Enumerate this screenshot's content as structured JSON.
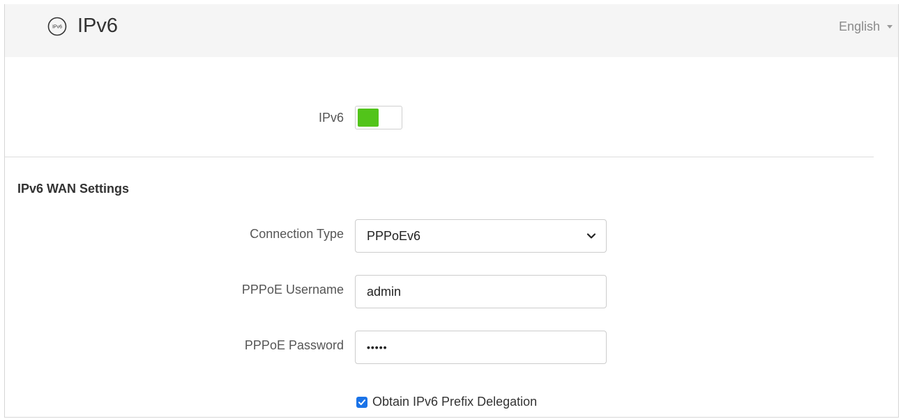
{
  "header": {
    "title": "IPv6",
    "icon": "ipv6-badge-icon",
    "icon_text": "IPv6",
    "language": {
      "selected": "English"
    }
  },
  "ipv6_toggle": {
    "label": "IPv6",
    "enabled": true,
    "on_color": "#52c41a"
  },
  "wan_settings": {
    "section_title": "IPv6 WAN Settings",
    "connection_type": {
      "label": "Connection Type",
      "value": "PPPoEv6"
    },
    "username": {
      "label": "PPPoE Username",
      "value": "admin"
    },
    "password": {
      "label": "PPPoE Password",
      "masked_value": "•••••"
    },
    "prefix_delegation": {
      "label": "Obtain IPv6 Prefix Delegation",
      "checked": true
    }
  },
  "colors": {
    "header_bg": "#f5f5f5",
    "accent_green": "#52c41a",
    "checkbox_blue": "#1a73e8"
  }
}
